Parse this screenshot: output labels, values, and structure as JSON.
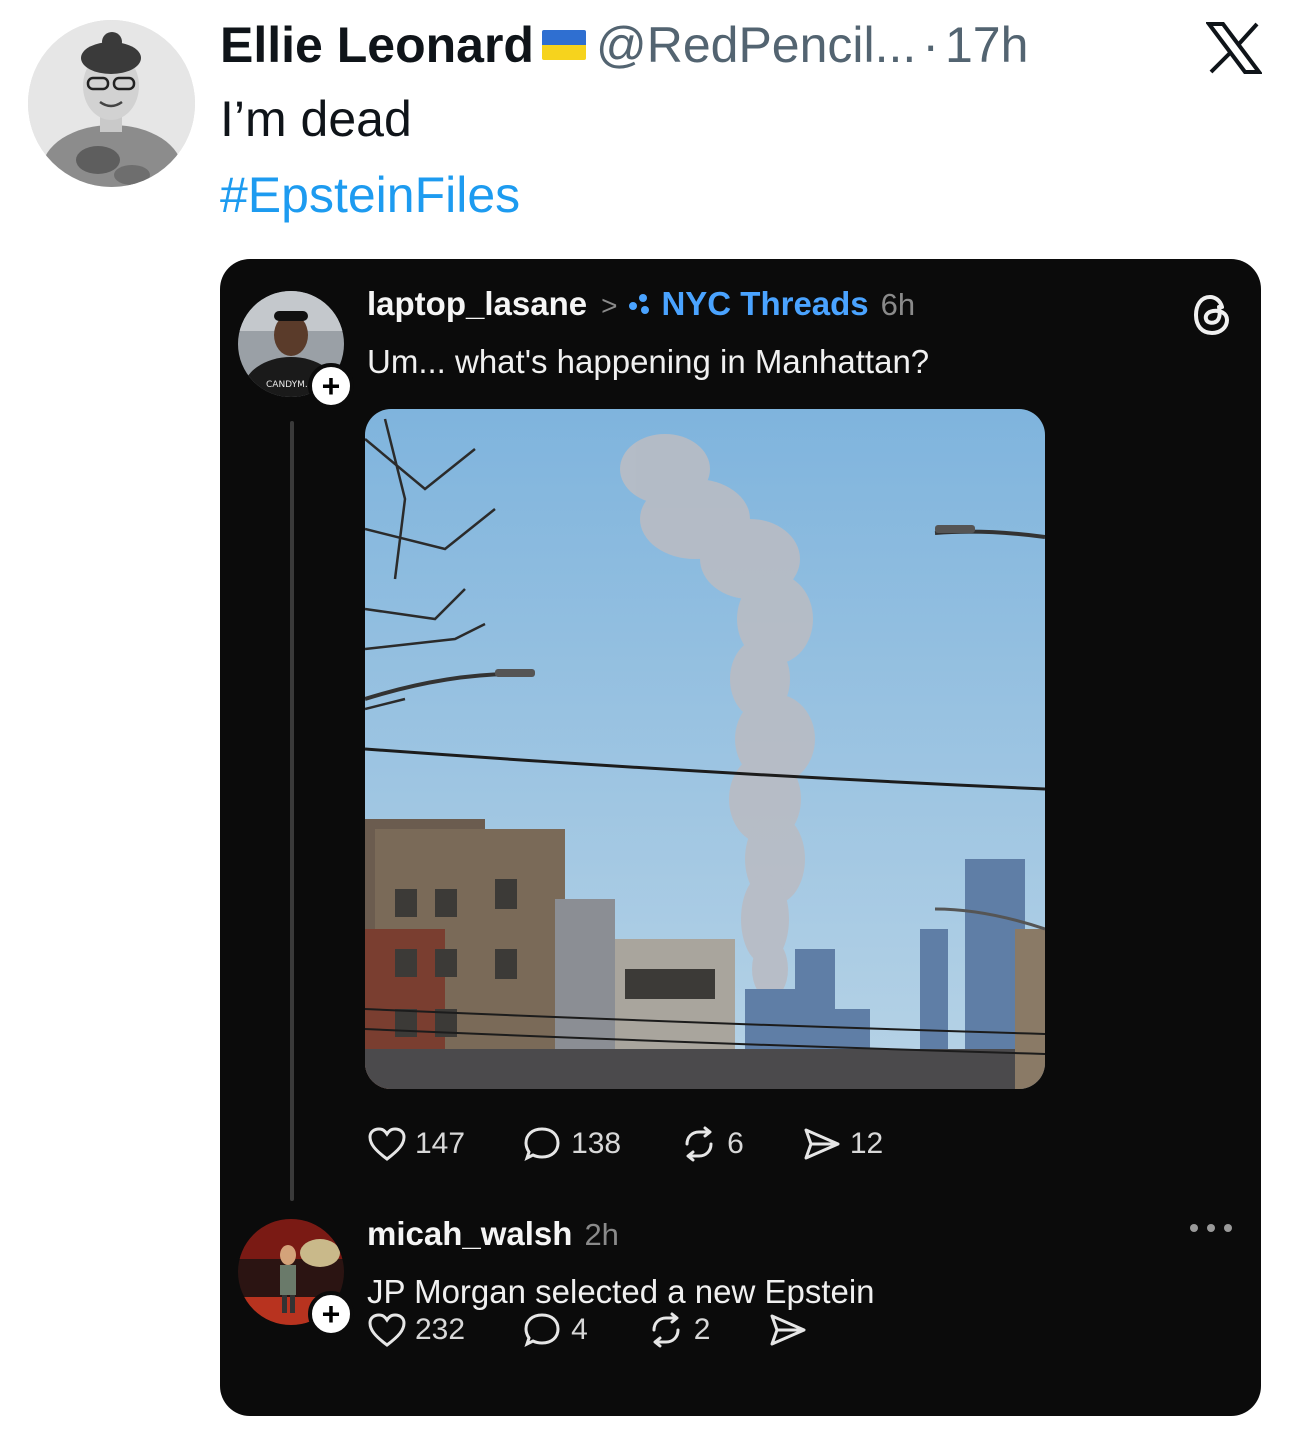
{
  "tweet": {
    "author_name": "Ellie Leonard",
    "handle": "@RedPencil...",
    "separator": "·",
    "time": "17h",
    "text": "I’m dead",
    "hashtag": "#EpsteinFiles",
    "platform_icon": "x-logo-icon",
    "flag_icon": "ukraine-flag-icon"
  },
  "threads_post": {
    "username": "laptop_lasane",
    "community": "NYC Threads",
    "time": "6h",
    "text": "Um... what's happening in Manhattan?",
    "avatar_shirt_text": "CANDYM.",
    "stats": {
      "likes": "147",
      "replies": "138",
      "reposts": "6",
      "shares": "12"
    }
  },
  "threads_reply": {
    "username": "micah_walsh",
    "time": "2h",
    "text": "JP Morgan selected a new Epstein",
    "stats": {
      "likes": "232",
      "replies": "4",
      "reposts": "2"
    }
  },
  "colors": {
    "hashtag": "#1d9bf0",
    "community": "#4aa3ff",
    "card_bg": "#0b0b0b",
    "sky": "#8fbde0"
  }
}
